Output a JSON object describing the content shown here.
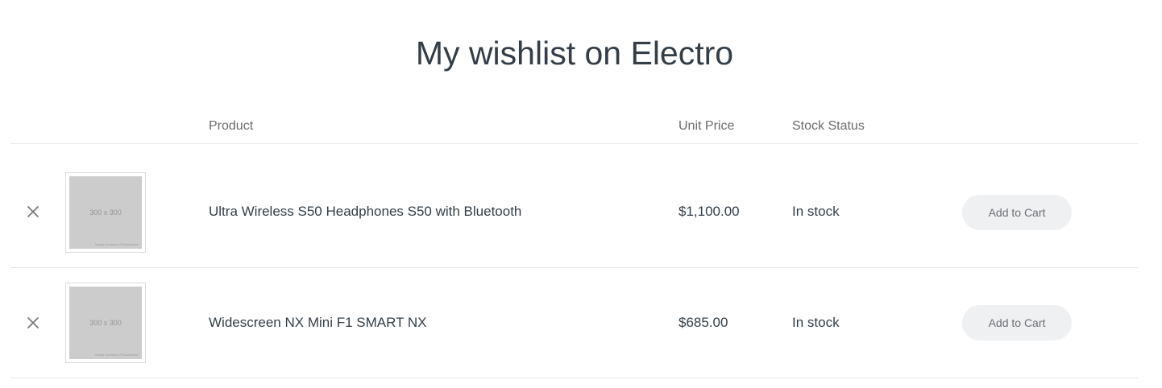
{
  "page": {
    "title": "My wishlist on Electro"
  },
  "table": {
    "headers": {
      "product": "Product",
      "unit_price": "Unit Price",
      "stock_status": "Stock Status"
    },
    "rows": [
      {
        "remove_icon": "close-icon",
        "image_label": "300 x 300",
        "image_credit": "Image courtesy of Placeholder",
        "name": "Ultra Wireless S50 Headphones S50 with Bluetooth",
        "price": "$1,100.00",
        "stock": "In stock",
        "action": "Add to Cart"
      },
      {
        "remove_icon": "close-icon",
        "image_label": "300 x 300",
        "image_credit": "Image courtesy of Placeholder",
        "name": "Widescreen NX Mini F1 SMART NX",
        "price": "$685.00",
        "stock": "In stock",
        "action": "Add to Cart"
      }
    ]
  },
  "colors": {
    "text": "#333e48",
    "header_text": "#6c6c6c",
    "button_bg": "#eff0f2",
    "divider": "#e6e6e6",
    "placeholder_bg": "#cccccc"
  }
}
